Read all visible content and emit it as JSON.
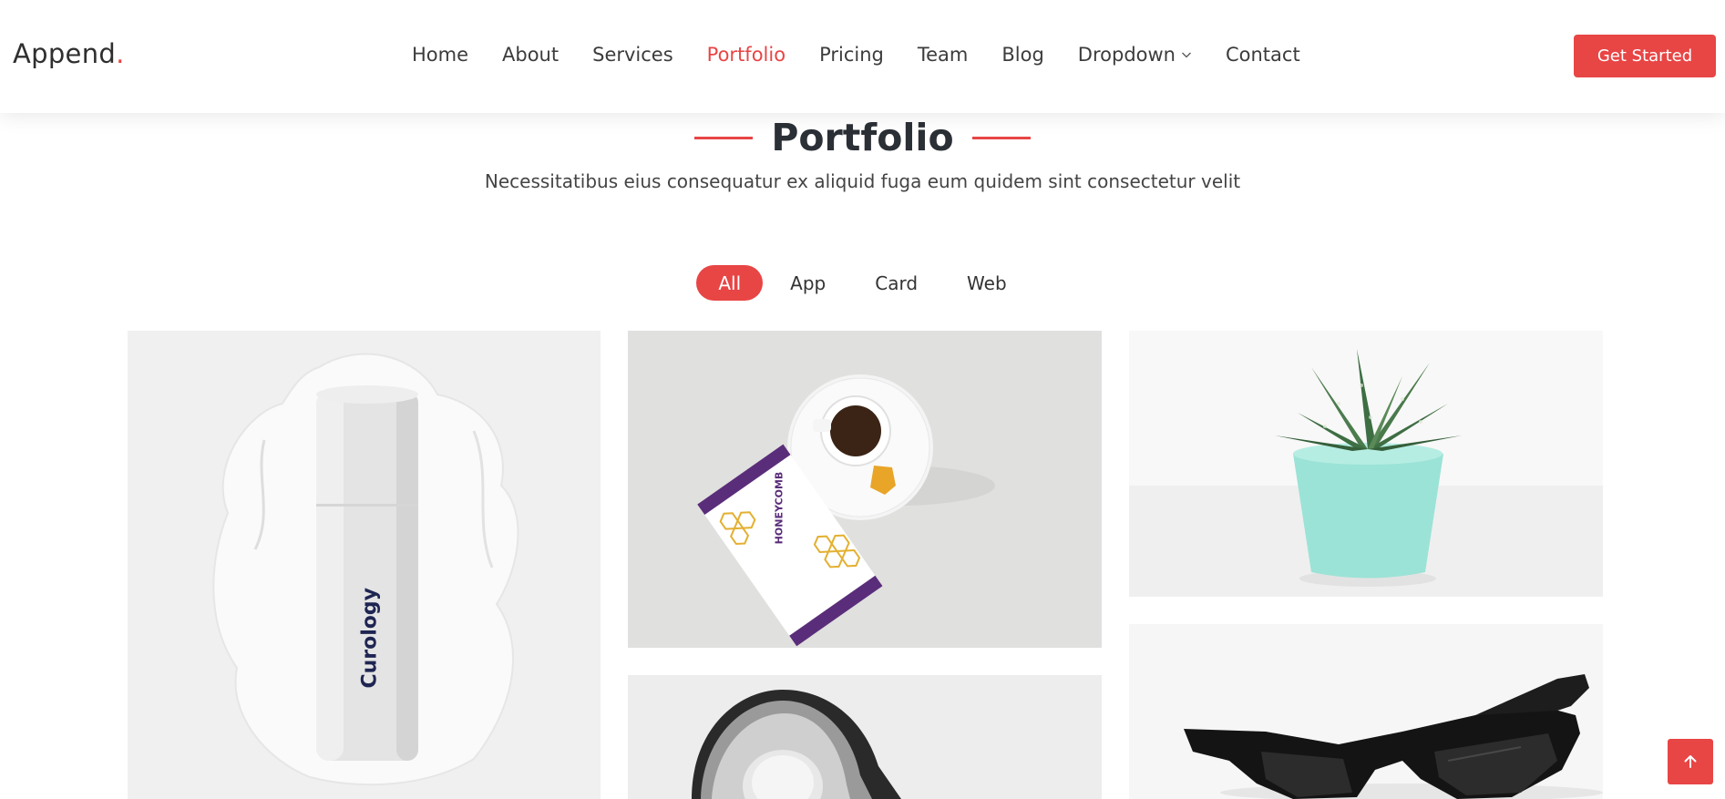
{
  "brand": {
    "name": "Append",
    "dot": "."
  },
  "nav": {
    "items": [
      {
        "label": "Home"
      },
      {
        "label": "About"
      },
      {
        "label": "Services"
      },
      {
        "label": "Portfolio"
      },
      {
        "label": "Pricing"
      },
      {
        "label": "Team"
      },
      {
        "label": "Blog"
      },
      {
        "label": "Dropdown"
      },
      {
        "label": "Contact"
      }
    ],
    "active": "Portfolio",
    "cta_label": "Get Started"
  },
  "section": {
    "title": "Portfolio",
    "subtitle": "Necessitatibus eius consequatur ex aliquid fuga eum quidem sint consectetur velit"
  },
  "filters": [
    {
      "label": "All",
      "active": true
    },
    {
      "label": "App"
    },
    {
      "label": "Card"
    },
    {
      "label": "Web"
    }
  ],
  "portfolio_items": [
    {
      "image": "skincare-bottle",
      "printed_text": "Curology"
    },
    {
      "image": "honeycomb-tea",
      "printed_text": "HONEYCOMB"
    },
    {
      "image": "potted-succulent"
    },
    {
      "image": "pendant-lamp"
    },
    {
      "image": "black-sunglasses"
    }
  ],
  "colors": {
    "accent": "#e84545",
    "text": "#2b2f36"
  },
  "icons": {
    "dropdown": "chevron-down-icon",
    "back_to_top": "arrow-up-icon"
  }
}
